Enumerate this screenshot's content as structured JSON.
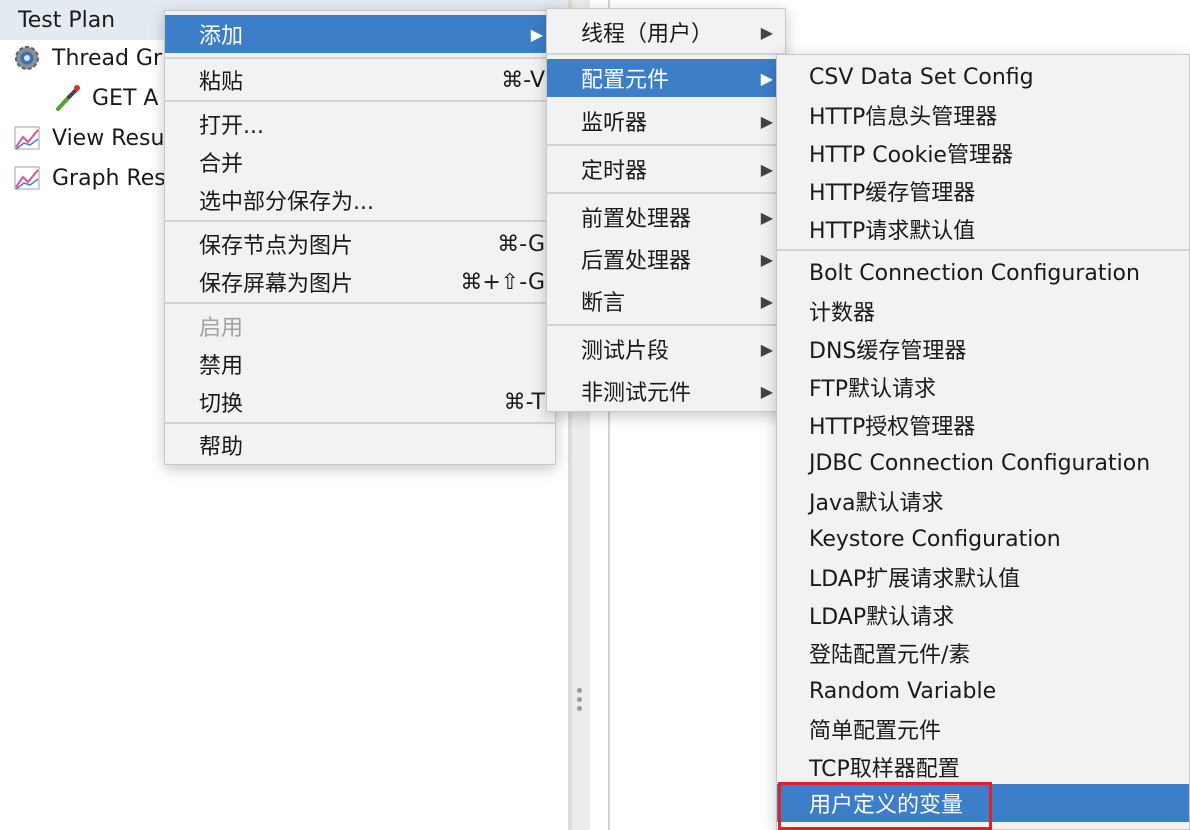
{
  "tree": {
    "items": [
      {
        "label": "Test Plan",
        "icon": "test-plan-icon"
      },
      {
        "label": "Thread Gr",
        "icon": "gear-icon"
      },
      {
        "label": "GET A",
        "icon": "sampler-pipette-icon"
      },
      {
        "label": "View Resu",
        "icon": "graph-listener-icon"
      },
      {
        "label": "Graph Res",
        "icon": "graph-listener-icon"
      }
    ]
  },
  "menu1": {
    "add": "添加",
    "paste": "粘贴",
    "paste_sc": "⌘-V",
    "open": "打开...",
    "merge": "合并",
    "save_selection": "选中部分保存为...",
    "save_node_img": "保存节点为图片",
    "save_node_img_sc": "⌘-G",
    "save_screen_img": "保存屏幕为图片",
    "save_screen_img_sc": "⌘+⇧-G",
    "enable": "启用",
    "disable": "禁用",
    "toggle": "切换",
    "toggle_sc": "⌘-T",
    "help": "帮助"
  },
  "menu2": {
    "items": [
      "线程（用户）",
      "配置元件",
      "监听器",
      "定时器",
      "前置处理器",
      "后置处理器",
      "断言",
      "测试片段",
      "非测试元件"
    ]
  },
  "menu3": {
    "items": [
      "CSV Data Set Config",
      "HTTP信息头管理器",
      "HTTP Cookie管理器",
      "HTTP缓存管理器",
      "HTTP请求默认值",
      "Bolt Connection Configuration",
      "计数器",
      "DNS缓存管理器",
      "FTP默认请求",
      "HTTP授权管理器",
      "JDBC Connection Configuration",
      "Java默认请求",
      "Keystore Configuration",
      "LDAP扩展请求默认值",
      "LDAP默认请求",
      "登陆配置元件/素",
      "Random Variable",
      "简单配置元件",
      "TCP取样器配置",
      "用户定义的变量"
    ]
  },
  "colors": {
    "menu_highlight": "#3d7ec9",
    "annotation_box": "#e0202a"
  }
}
